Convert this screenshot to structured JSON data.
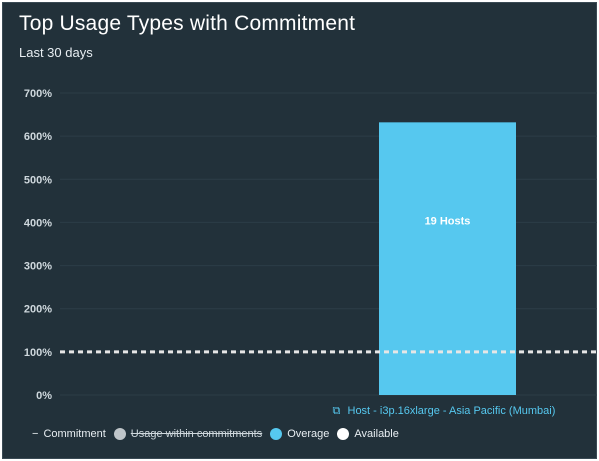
{
  "header": {
    "title": "Top Usage Types with Commitment",
    "subtitle": "Last 30 days"
  },
  "legend": {
    "commitment_symbol": "−",
    "commitment": "Commitment",
    "usage_within": "Usage within commitments",
    "overage": "Overage",
    "available": "Available"
  },
  "colors": {
    "background": "#22313a",
    "overage": "#56c8ef",
    "usage_within": "#bfc5c9",
    "available": "#ffffff",
    "commitment_line": "#e6e6e6"
  },
  "chart_data": {
    "type": "bar",
    "title": "Top Usage Types with Commitment",
    "subtitle": "Last 30 days",
    "categories": [
      "Host - i3p.16xlarge - Asia Pacific (Mumbai)"
    ],
    "series": [
      {
        "name": "Overage",
        "values": [
          632
        ],
        "labels": [
          "19 Hosts"
        ]
      }
    ],
    "commitment_line": 100,
    "yticks": [
      "0%",
      "100%",
      "200%",
      "300%",
      "400%",
      "500%",
      "600%",
      "700%"
    ],
    "ylim": [
      0,
      700
    ],
    "ylabel": "",
    "xlabel": "",
    "grid": true,
    "legend_position": "bottom"
  }
}
